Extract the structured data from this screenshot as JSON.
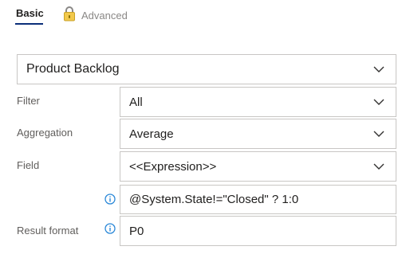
{
  "tabs": {
    "basic_label": "Basic",
    "advanced_label": "Advanced",
    "advanced_icon": "lock-icon",
    "active": "Basic",
    "accent_color": "#0b2e79"
  },
  "backlog_select": {
    "value": "Product Backlog",
    "icon": "chevron-down-icon"
  },
  "filter": {
    "label": "Filter",
    "value": "All",
    "icon": "chevron-down-icon"
  },
  "aggregation": {
    "label": "Aggregation",
    "value": "Average",
    "icon": "chevron-down-icon"
  },
  "field": {
    "label": "Field",
    "value": "<<Expression>>",
    "icon": "chevron-down-icon"
  },
  "expression": {
    "value": "@System.State!=\"Closed\" ? 1:0",
    "icon": "info-icon"
  },
  "result_format": {
    "label": "Result format",
    "value": "P0",
    "icon": "info-icon"
  },
  "colors": {
    "info_icon": "#2b88d8",
    "border": "#c8c6c4",
    "label_text": "#605e5c"
  }
}
